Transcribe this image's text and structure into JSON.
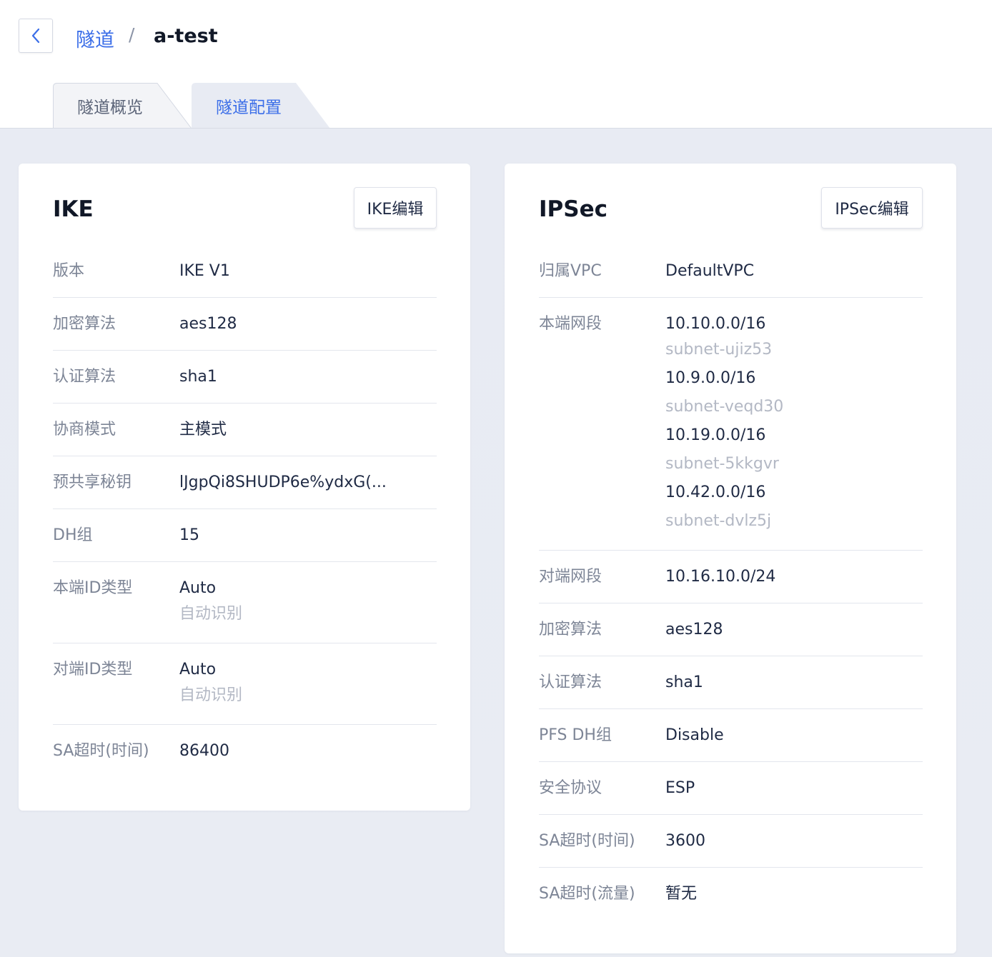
{
  "breadcrumb": {
    "parent": "隧道",
    "separator": "/",
    "current": "a-test"
  },
  "tabs": [
    {
      "label": "隧道概览",
      "active": false
    },
    {
      "label": "隧道配置",
      "active": true
    }
  ],
  "colors": {
    "accent": "#3b6ee8",
    "content_bg": "#e8ebf3",
    "muted_text": "#b3b8c4"
  },
  "ike": {
    "title": "IKE",
    "edit_label": "IKE编辑",
    "rows": [
      {
        "label": "版本",
        "value": "IKE V1"
      },
      {
        "label": "加密算法",
        "value": "aes128"
      },
      {
        "label": "认证算法",
        "value": "sha1"
      },
      {
        "label": "协商模式",
        "value": "主模式"
      },
      {
        "label": "预共享秘钥",
        "value": "lJgpQi8SHUDP6e%ydxG(..."
      },
      {
        "label": "DH组",
        "value": "15"
      },
      {
        "label": "本端ID类型",
        "value": "Auto",
        "sub": "自动识别"
      },
      {
        "label": "对端ID类型",
        "value": "Auto",
        "sub": "自动识别"
      },
      {
        "label": "SA超时(时间)",
        "value": "86400"
      }
    ]
  },
  "ipsec": {
    "title": "IPSec",
    "edit_label": "IPSec编辑",
    "vpc": {
      "label": "归属VPC",
      "value": "DefaultVPC"
    },
    "local_segments": {
      "label": "本端网段",
      "items": [
        {
          "cidr": "10.10.0.0/16",
          "subnet": "subnet-ujiz53"
        },
        {
          "cidr": "10.9.0.0/16",
          "subnet": "subnet-veqd30"
        },
        {
          "cidr": "10.19.0.0/16",
          "subnet": "subnet-5kkgvr"
        },
        {
          "cidr": "10.42.0.0/16",
          "subnet": "subnet-dvlz5j"
        }
      ]
    },
    "rows": [
      {
        "label": "对端网段",
        "value": "10.16.10.0/24"
      },
      {
        "label": "加密算法",
        "value": "aes128"
      },
      {
        "label": "认证算法",
        "value": "sha1"
      },
      {
        "label": "PFS DH组",
        "value": "Disable"
      },
      {
        "label": "安全协议",
        "value": "ESP"
      },
      {
        "label": "SA超时(时间)",
        "value": "3600"
      },
      {
        "label": "SA超时(流量)",
        "value": "暂无"
      }
    ]
  }
}
